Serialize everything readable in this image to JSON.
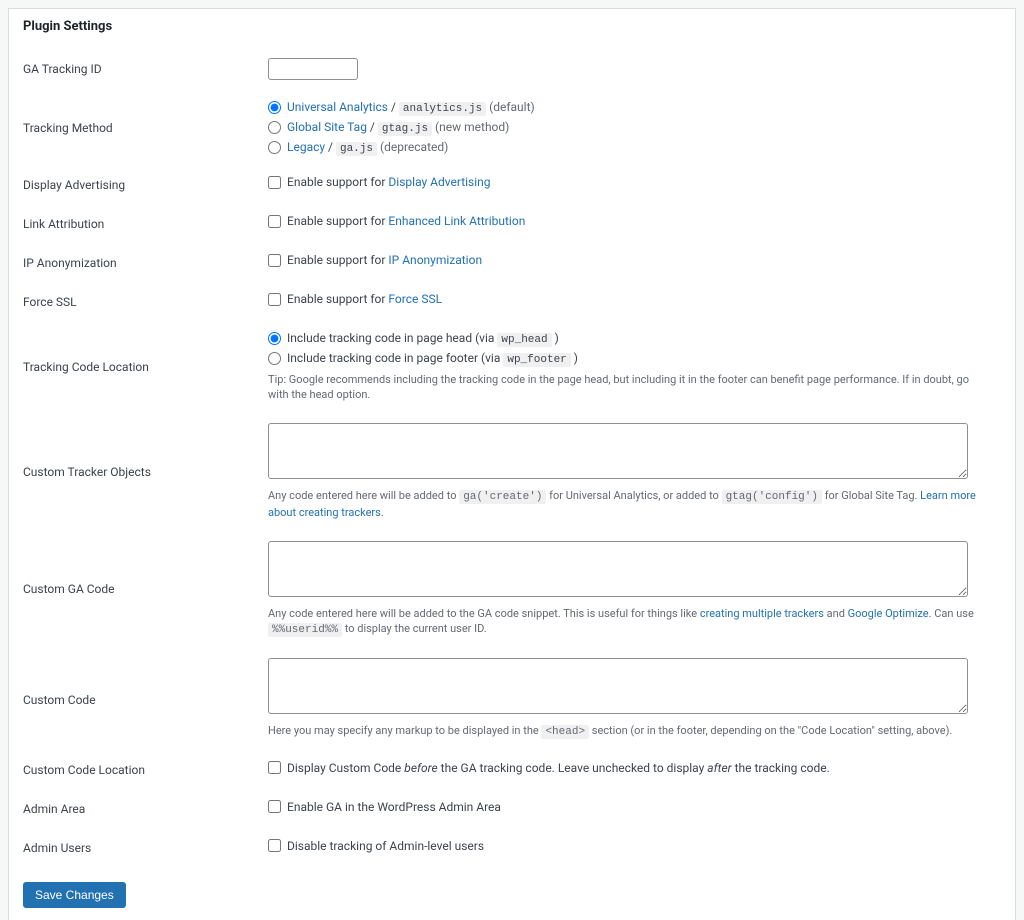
{
  "title": "Plugin Settings",
  "fields": {
    "ga_tracking_id": {
      "label": "GA Tracking ID",
      "value": ""
    },
    "tracking_method": {
      "label": "Tracking Method",
      "options": [
        {
          "link": "Universal Analytics",
          "sep": " / ",
          "code": "analytics.js",
          "suffix": " (default)",
          "checked": true
        },
        {
          "link": "Global Site Tag",
          "sep": " / ",
          "code": "gtag.js",
          "suffix": " (new method)",
          "checked": false
        },
        {
          "link": "Legacy",
          "sep": " / ",
          "code": "ga.js",
          "suffix": " (deprecated)",
          "checked": false
        }
      ]
    },
    "display_advertising": {
      "label": "Display Advertising",
      "text_before": "Enable support for ",
      "link": "Display Advertising",
      "checked": false
    },
    "link_attribution": {
      "label": "Link Attribution",
      "text_before": "Enable support for ",
      "link": "Enhanced Link Attribution",
      "checked": false
    },
    "ip_anonymization": {
      "label": "IP Anonymization",
      "text_before": "Enable support for ",
      "link": "IP Anonymization",
      "checked": false
    },
    "force_ssl": {
      "label": "Force SSL",
      "text_before": "Enable support for ",
      "link": "Force SSL",
      "checked": false
    },
    "code_location": {
      "label": "Tracking Code Location",
      "options": [
        {
          "text": "Include tracking code in page head (via ",
          "code": "wp_head",
          "close": " )",
          "checked": true
        },
        {
          "text": "Include tracking code in page footer (via ",
          "code": "wp_footer",
          "close": " )",
          "checked": false
        }
      ],
      "tip": "Tip: Google recommends including the tracking code in the page head, but including it in the footer can benefit page performance. If in doubt, go with the head option."
    },
    "custom_tracker": {
      "label": "Custom Tracker Objects",
      "desc_before": "Any code entered here will be added to ",
      "code1": "ga('create')",
      "mid1": " for Universal Analytics, or added to ",
      "code2": "gtag('config')",
      "mid2": " for Global Site Tag. ",
      "link": "Learn more about creating trackers",
      "after": "."
    },
    "custom_ga": {
      "label": "Custom GA Code",
      "desc_before": "Any code entered here will be added to the GA code snippet. This is useful for things like ",
      "link1": "creating multiple trackers",
      "and": " and ",
      "link2": "Google Optimize",
      "mid": ". Can use ",
      "code": "%%userid%%",
      "after": " to display the current user ID."
    },
    "custom_code": {
      "label": "Custom Code",
      "desc_before": "Here you may specify any markup to be displayed in the ",
      "code": "<head>",
      "after": " section (or in the footer, depending on the \"Code Location\" setting, above)."
    },
    "custom_code_location": {
      "label": "Custom Code Location",
      "text_before": "Display Custom Code ",
      "em1": "before",
      "mid": " the GA tracking code. Leave unchecked to display ",
      "em2": "after",
      "after": " the tracking code.",
      "checked": false
    },
    "admin_area": {
      "label": "Admin Area",
      "text": "Enable GA in the WordPress Admin Area",
      "checked": false
    },
    "admin_users": {
      "label": "Admin Users",
      "text": "Disable tracking of Admin-level users",
      "checked": false
    }
  },
  "save_button": "Save Changes"
}
